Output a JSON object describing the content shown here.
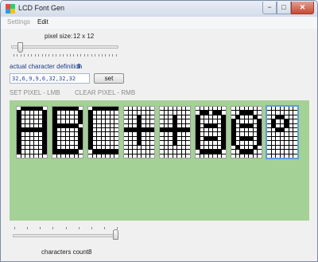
{
  "window": {
    "title": "LCD Font Gen",
    "minimize": "−",
    "maximize": "□",
    "close": "✕"
  },
  "menu": {
    "settings": "Settings",
    "edit": "Edit"
  },
  "pixel_size": {
    "label": "pixel size:",
    "value": "12 x 12",
    "slider_fraction": 0.06
  },
  "definition": {
    "label": "actual character definition",
    "index": "8",
    "value": "32,6,9,9,6,32,32,32",
    "set_button": "set"
  },
  "hints": {
    "set": "SET PIXEL - LMB",
    "clear": "CLEAR PIXEL - RMB"
  },
  "characters_count": {
    "label": "characters count:",
    "value": "8",
    "slider_fraction": 1.0
  },
  "colors": {
    "canvas": "#a4d195",
    "pixel_on": "#000000",
    "pixel_off": "#ffffff",
    "accent": "#2545a0"
  },
  "glyphs": [
    {
      "name": "A",
      "rows": [
        "0111110",
        "1000001",
        "1000001",
        "1000001",
        "1000001",
        "1111111",
        "1000001",
        "1000001",
        "1000001",
        "1000001",
        "1000001",
        "0000000"
      ]
    },
    {
      "name": "B",
      "rows": [
        "1111110",
        "1000001",
        "1000001",
        "1000001",
        "1111110",
        "1000001",
        "1000001",
        "1000001",
        "1000001",
        "1000001",
        "1111110",
        "0000000"
      ]
    },
    {
      "name": "C",
      "rows": [
        "0111111",
        "1000000",
        "1000000",
        "1000000",
        "1000000",
        "1000000",
        "1000000",
        "1000000",
        "1000000",
        "1000000",
        "0111111",
        "0000000"
      ]
    },
    {
      "name": "+",
      "rows": [
        "0000000",
        "0000000",
        "0001000",
        "0001000",
        "0001000",
        "1111111",
        "0001000",
        "0001000",
        "0001000",
        "0000000",
        "0000000",
        "0000000"
      ]
    },
    {
      "name": "+",
      "rows": [
        "0000000",
        "0000000",
        "0001000",
        "0001000",
        "0001000",
        "1111111",
        "0001000",
        "0001000",
        "0001000",
        "0000000",
        "0000000",
        "0000000"
      ]
    },
    {
      "name": "smile",
      "rows": [
        "0000000",
        "0110110",
        "1000001",
        "1000001",
        "1011101",
        "1000001",
        "1000001",
        "1011101",
        "1000001",
        "1000001",
        "0111110",
        "0000000"
      ]
    },
    {
      "name": "face",
      "rows": [
        "0000000",
        "0011100",
        "0100010",
        "1000001",
        "1011101",
        "1000001",
        "1000001",
        "1011101",
        "1000001",
        "0100010",
        "0011100",
        "0000000"
      ]
    },
    {
      "name": "degree",
      "rows": [
        "0000000",
        "0000000",
        "0011000",
        "0100100",
        "0100100",
        "0011000",
        "0000000",
        "0000000",
        "0000000",
        "0000000",
        "0000000",
        "0000000"
      ]
    }
  ]
}
